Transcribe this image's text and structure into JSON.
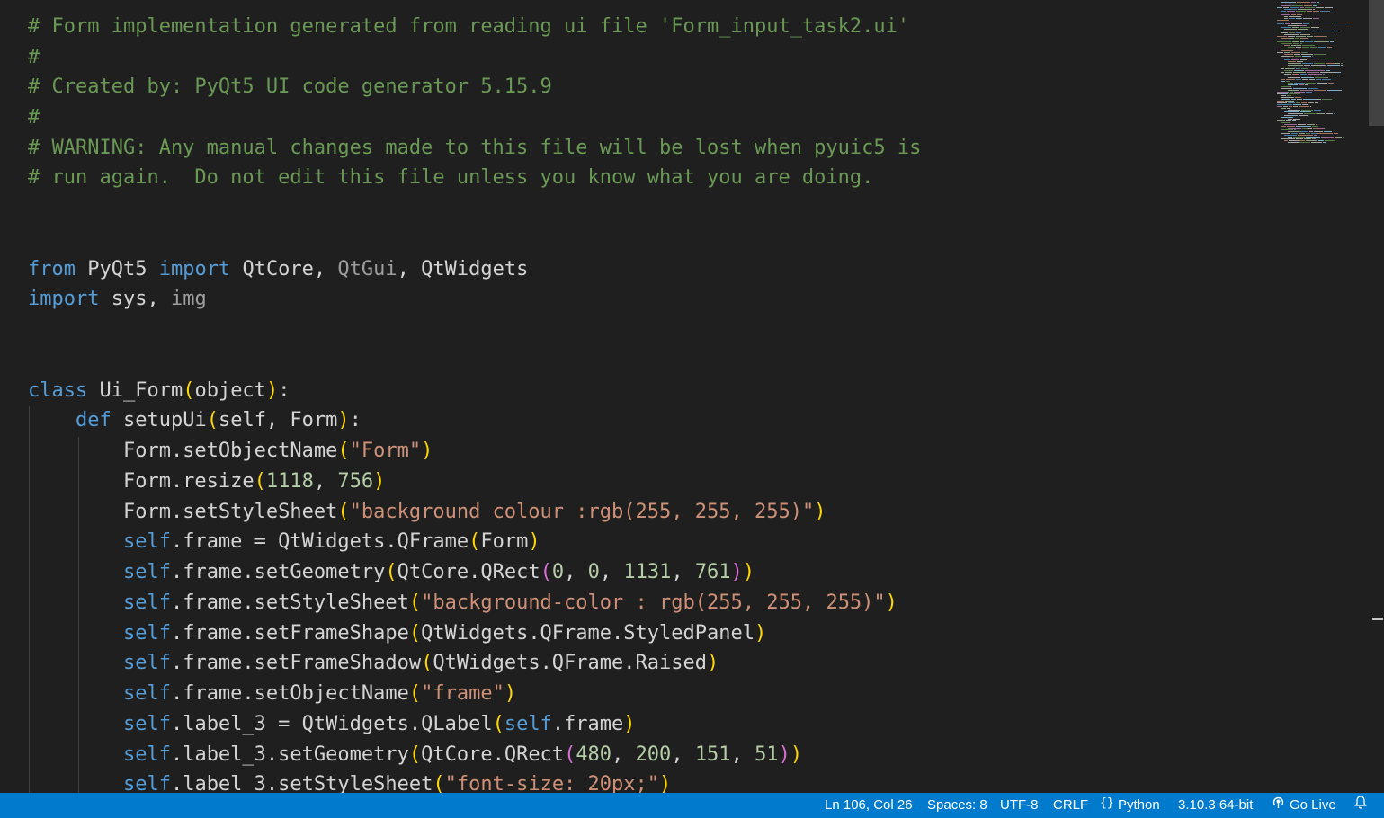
{
  "editor": {
    "language": "python",
    "lines": [
      [
        [
          "# Form implementation generated from reading ui file 'Form_input_task2.ui'",
          "comment"
        ]
      ],
      [
        [
          "#",
          "comment"
        ]
      ],
      [
        [
          "# Created by: PyQt5 UI code generator 5.15.9",
          "comment"
        ]
      ],
      [
        [
          "#",
          "comment"
        ]
      ],
      [
        [
          "# WARNING: Any manual changes made to this file will be lost when pyuic5 is",
          "comment"
        ]
      ],
      [
        [
          "# run again.  Do not edit this file unless you know what you are doing.",
          "comment"
        ]
      ],
      [],
      [],
      [],
      [
        [
          "from",
          "keyword"
        ],
        [
          " ",
          "plain"
        ],
        [
          "PyQt5",
          "plain"
        ],
        [
          " ",
          "plain"
        ],
        [
          "import",
          "keyword"
        ],
        [
          " QtCore, ",
          "plain"
        ],
        [
          "QtGui",
          "unused"
        ],
        [
          ", QtWidgets",
          "plain"
        ]
      ],
      [
        [
          "import",
          "keyword"
        ],
        [
          " sys, ",
          "plain"
        ],
        [
          "img",
          "unused"
        ]
      ],
      [],
      [],
      [
        [
          "class",
          "keyword"
        ],
        [
          " ",
          "plain"
        ],
        [
          "Ui_Form",
          "plain"
        ],
        [
          "(",
          "bracket1"
        ],
        [
          "object",
          "plain"
        ],
        [
          ")",
          "bracket1"
        ],
        [
          ":",
          "plain"
        ]
      ],
      [
        [
          "    ",
          "plain"
        ],
        [
          "def",
          "keyword"
        ],
        [
          " ",
          "plain"
        ],
        [
          "setupUi",
          "plain"
        ],
        [
          "(",
          "bracket1"
        ],
        [
          "self, Form",
          "plain"
        ],
        [
          ")",
          "bracket1"
        ],
        [
          ":",
          "plain"
        ]
      ],
      [
        [
          "        Form.setObjectName",
          "plain"
        ],
        [
          "(",
          "bracket1"
        ],
        [
          "\"Form\"",
          "string"
        ],
        [
          ")",
          "bracket1"
        ]
      ],
      [
        [
          "        Form.resize",
          "plain"
        ],
        [
          "(",
          "bracket1"
        ],
        [
          "1118",
          "number"
        ],
        [
          ", ",
          "plain"
        ],
        [
          "756",
          "number"
        ],
        [
          ")",
          "bracket1"
        ]
      ],
      [
        [
          "        Form.setStyleSheet",
          "plain"
        ],
        [
          "(",
          "bracket1"
        ],
        [
          "\"background colour :rgb(255, 255, 255)\"",
          "string"
        ],
        [
          ")",
          "bracket1"
        ]
      ],
      [
        [
          "        ",
          "plain"
        ],
        [
          "self",
          "keyword"
        ],
        [
          ".frame = QtWidgets.QFrame",
          "plain"
        ],
        [
          "(",
          "bracket1"
        ],
        [
          "Form",
          "plain"
        ],
        [
          ")",
          "bracket1"
        ]
      ],
      [
        [
          "        ",
          "plain"
        ],
        [
          "self",
          "keyword"
        ],
        [
          ".frame.setGeometry",
          "plain"
        ],
        [
          "(",
          "bracket1"
        ],
        [
          "QtCore.QRect",
          "plain"
        ],
        [
          "(",
          "bracket2"
        ],
        [
          "0",
          "number"
        ],
        [
          ", ",
          "plain"
        ],
        [
          "0",
          "number"
        ],
        [
          ", ",
          "plain"
        ],
        [
          "1131",
          "number"
        ],
        [
          ", ",
          "plain"
        ],
        [
          "761",
          "number"
        ],
        [
          ")",
          "bracket2"
        ],
        [
          ")",
          "bracket1"
        ]
      ],
      [
        [
          "        ",
          "plain"
        ],
        [
          "self",
          "keyword"
        ],
        [
          ".frame.setStyleSheet",
          "plain"
        ],
        [
          "(",
          "bracket1"
        ],
        [
          "\"background-color : rgb(255, 255, 255)\"",
          "string"
        ],
        [
          ")",
          "bracket1"
        ]
      ],
      [
        [
          "        ",
          "plain"
        ],
        [
          "self",
          "keyword"
        ],
        [
          ".frame.setFrameShape",
          "plain"
        ],
        [
          "(",
          "bracket1"
        ],
        [
          "QtWidgets.QFrame.StyledPanel",
          "plain"
        ],
        [
          ")",
          "bracket1"
        ]
      ],
      [
        [
          "        ",
          "plain"
        ],
        [
          "self",
          "keyword"
        ],
        [
          ".frame.setFrameShadow",
          "plain"
        ],
        [
          "(",
          "bracket1"
        ],
        [
          "QtWidgets.QFrame.Raised",
          "plain"
        ],
        [
          ")",
          "bracket1"
        ]
      ],
      [
        [
          "        ",
          "plain"
        ],
        [
          "self",
          "keyword"
        ],
        [
          ".frame.setObjectName",
          "plain"
        ],
        [
          "(",
          "bracket1"
        ],
        [
          "\"frame\"",
          "string"
        ],
        [
          ")",
          "bracket1"
        ]
      ],
      [
        [
          "        ",
          "plain"
        ],
        [
          "self",
          "keyword"
        ],
        [
          ".label_3 = QtWidgets.QLabel",
          "plain"
        ],
        [
          "(",
          "bracket1"
        ],
        [
          "self",
          "keyword"
        ],
        [
          ".frame",
          "plain"
        ],
        [
          ")",
          "bracket1"
        ]
      ],
      [
        [
          "        ",
          "plain"
        ],
        [
          "self",
          "keyword"
        ],
        [
          ".label_3.setGeometry",
          "plain"
        ],
        [
          "(",
          "bracket1"
        ],
        [
          "QtCore.QRect",
          "plain"
        ],
        [
          "(",
          "bracket2"
        ],
        [
          "480",
          "number"
        ],
        [
          ", ",
          "plain"
        ],
        [
          "200",
          "number"
        ],
        [
          ", ",
          "plain"
        ],
        [
          "151",
          "number"
        ],
        [
          ", ",
          "plain"
        ],
        [
          "51",
          "number"
        ],
        [
          ")",
          "bracket2"
        ],
        [
          ")",
          "bracket1"
        ]
      ],
      [
        [
          "        ",
          "plain"
        ],
        [
          "self",
          "keyword"
        ],
        [
          ".label_3.setStyleSheet",
          "plain"
        ],
        [
          "(",
          "bracket1"
        ],
        [
          "\"font-size: 20px;\"",
          "string"
        ],
        [
          ")",
          "bracket1"
        ]
      ]
    ]
  },
  "colors": {
    "comment": "#6a9955",
    "keyword": "#569cd6",
    "plain": "#d4d4d4",
    "unused": "#9d9d9d",
    "string": "#ce9178",
    "number": "#b5cea8",
    "bracket1": "#ffd700",
    "bracket2": "#da70d6",
    "status_bg": "#007acc",
    "editor_bg": "#1f1f1f"
  },
  "statusbar": {
    "position": "Ln 106, Col 26",
    "indent": "Spaces: 8",
    "encoding": "UTF-8",
    "eol": "CRLF",
    "language": "Python",
    "interpreter": "3.10.3 64-bit",
    "golive": "Go Live",
    "language_icon": "braces-icon",
    "golive_icon": "broadcast-icon",
    "bell_icon": "bell-icon"
  }
}
